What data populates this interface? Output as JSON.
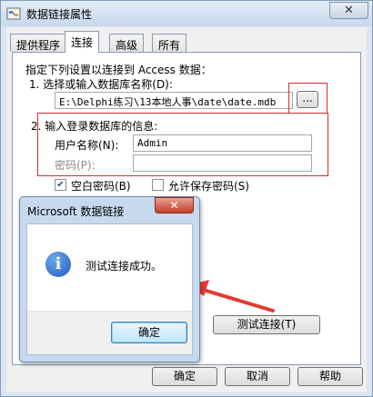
{
  "window": {
    "title": "数据链接属性",
    "close_glyph": "✕"
  },
  "tabs": [
    "提供程序",
    "连接",
    "高级",
    "所有"
  ],
  "connection": {
    "instruction": "指定下列设置以连接到 Access 数据：",
    "step1_label": "1. 选择或输入数据库名称(D):",
    "db_path": "E:\\Delphi练习\\13本地人事\\date\\date.mdb",
    "browse_label": "...",
    "step2_label": "2. 输入登录数据库的信息:",
    "username_label": "用户名称(N):",
    "username_value": "Admin",
    "password_label": "密码(P):",
    "password_value": "",
    "blank_password_label": "空白密码(B)",
    "blank_password_checked": true,
    "allow_save_label": "允许保存密码(S)",
    "allow_save_checked": false,
    "test_button_label": "测试连接(T)"
  },
  "footer": {
    "ok": "确定",
    "cancel": "取消",
    "help": "帮助"
  },
  "dialog": {
    "title": "Microsoft 数据链接",
    "close_glyph": "✕",
    "icon_glyph": "i",
    "message": "测试连接成功。",
    "ok_label": "确定"
  },
  "check_glyph": "✔",
  "colors": {
    "annotation_red": "#d9292f",
    "arrow_red": "#e53935"
  }
}
